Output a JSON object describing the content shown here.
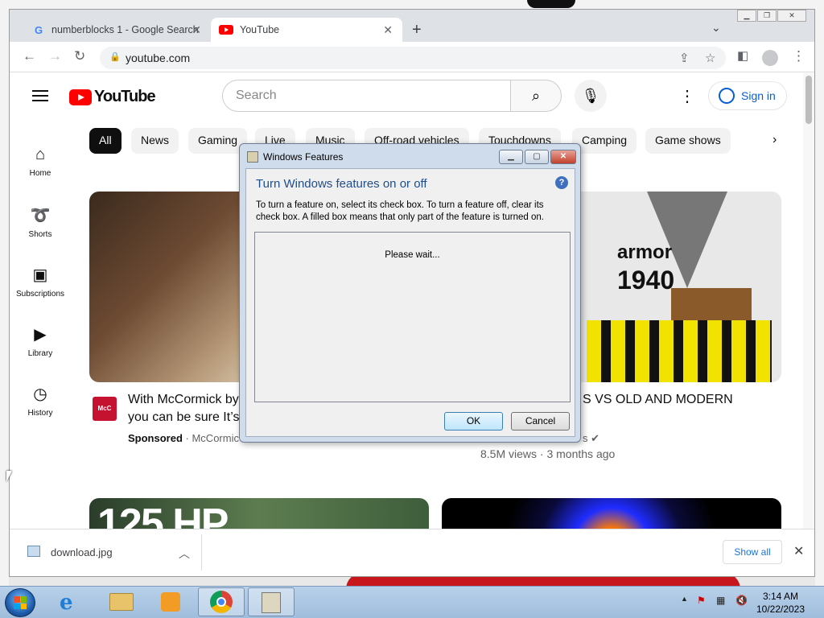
{
  "browser": {
    "tabs": [
      {
        "label": "numberblocks 1 - Google Search",
        "icon": "google-icon"
      },
      {
        "label": "YouTube",
        "icon": "youtube-icon"
      }
    ],
    "url": "youtube.com"
  },
  "youtube": {
    "logo_text": "YouTube",
    "search_placeholder": "Search",
    "sign_in": "Sign in",
    "sidebar": [
      {
        "label": "Home",
        "icon": "home-icon"
      },
      {
        "label": "Shorts",
        "icon": "shorts-icon"
      },
      {
        "label": "Subscriptions",
        "icon": "subscriptions-icon"
      },
      {
        "label": "Library",
        "icon": "library-icon"
      },
      {
        "label": "History",
        "icon": "history-icon"
      }
    ],
    "chips": [
      "All",
      "News",
      "Gaming",
      "Live",
      "Music",
      "Off-road vehicles",
      "Touchdowns",
      "Camping",
      "Game shows"
    ],
    "videos": [
      {
        "title_line1": "With McCormick by",
        "title_line2": "you can be sure It’s",
        "sponsored": "Sponsored",
        "channel": "· McCormic"
      },
      {
        "title": "S VS OLD AND MODERN",
        "channel_tail": "s",
        "meta": "8.5M views · 3 months ago",
        "thumb_text1": "armor",
        "thumb_text2": "1940"
      },
      {
        "thumb_text": "125 HP"
      }
    ]
  },
  "download_bar": {
    "filename": "download.jpg",
    "show_all": "Show all"
  },
  "dialog": {
    "title": "Windows Features",
    "heading": "Turn Windows features on or off",
    "description": "To turn a feature on, select its check box. To turn a feature off, clear its check box. A filled box means that only part of the feature is turned on.",
    "status": "Please wait...",
    "ok": "OK",
    "cancel": "Cancel"
  },
  "taskbar": {
    "time": "3:14 AM",
    "date": "10/22/2023"
  },
  "colors": {
    "youtube_red": "#ff0000",
    "link_blue": "#065fd4",
    "dialog_heading": "#1e4e8c"
  }
}
